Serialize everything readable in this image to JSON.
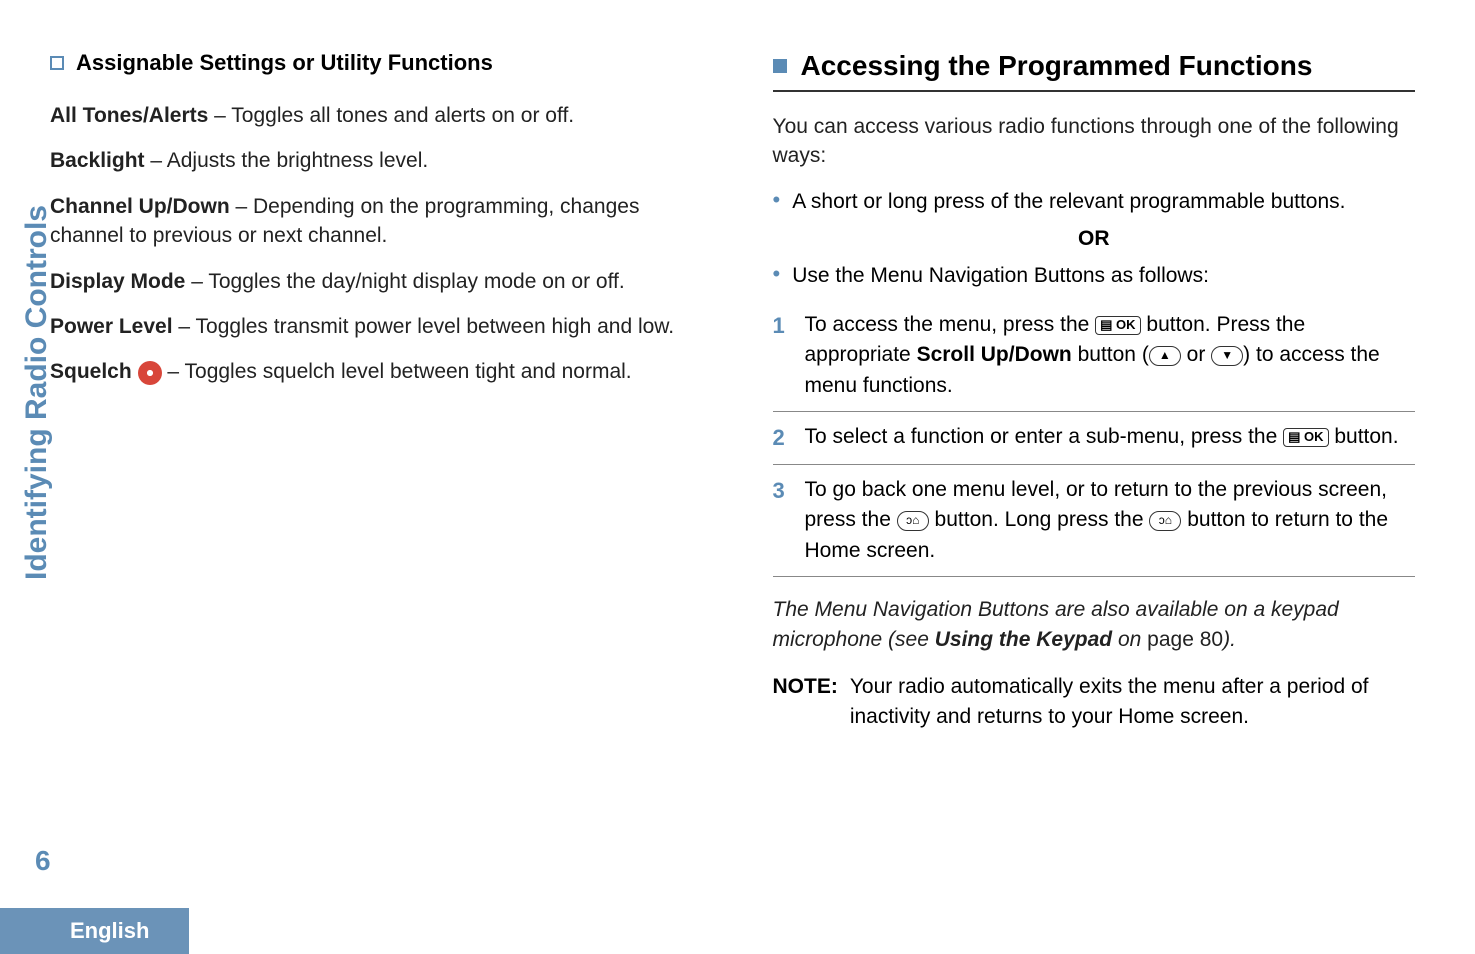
{
  "sidebar": {
    "label": "Identifying Radio Controls",
    "page_number": "6",
    "language": "English"
  },
  "left": {
    "section_title": "Assignable Settings or Utility Functions",
    "entries": {
      "all_tones_label": "All Tones/Alerts",
      "all_tones_desc": " – Toggles all tones and alerts on or off.",
      "backlight_label": "Backlight",
      "backlight_desc": " – Adjusts the brightness level.",
      "channel_label": "Channel Up/Down",
      "channel_desc": " – Depending on the programming, changes channel to previous or next channel.",
      "display_label": "Display Mode",
      "display_desc": " – Toggles the day/night display mode on or off.",
      "power_label": "Power Level",
      "power_desc": " – Toggles transmit power level between high and low.",
      "squelch_label": "Squelch",
      "squelch_desc": " – Toggles squelch level between tight and normal."
    }
  },
  "right": {
    "heading": "Accessing the Programmed Functions",
    "intro": "You can access various radio functions through one of the following ways:",
    "bullet1": "A short or long press of the relevant programmable buttons.",
    "or": "OR",
    "bullet2": "Use the Menu Navigation Buttons as follows:",
    "step1_a": "To access the menu, press the ",
    "step1_b": " button. Press the appropriate ",
    "step1_scroll": "Scroll Up/Down",
    "step1_c": " button (",
    "step1_d": " or ",
    "step1_e": ") to access the menu functions.",
    "step2_a": "To select a function or enter a sub-menu, press the ",
    "step2_b": " button.",
    "step3_a": "To go back one menu level, or to return to the previous screen, press the ",
    "step3_b": " button. Long press the ",
    "step3_c": " button to return to the Home screen.",
    "menu_note_a": "The Menu Navigation Buttons are also available on a keypad microphone (see ",
    "menu_note_bold": "Using the Keypad",
    "menu_note_b": " on ",
    "menu_note_page": "page 80",
    "menu_note_c": ").",
    "note_label": "NOTE:",
    "note_text": "Your radio automatically exits the menu after a period of inactivity and returns to your Home screen.",
    "ok_icon": "▤ OK"
  }
}
